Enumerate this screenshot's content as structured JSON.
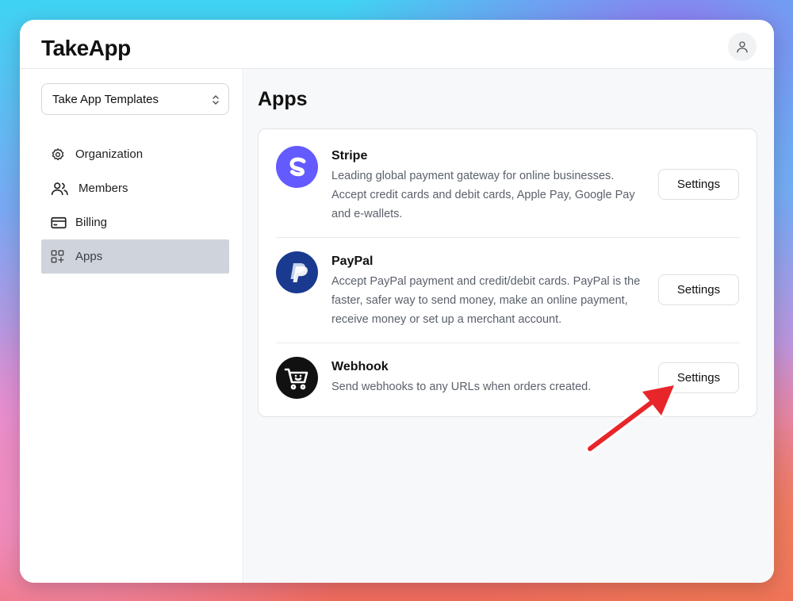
{
  "header": {
    "logo": "TakeApp",
    "user_icon": "user-icon"
  },
  "sidebar": {
    "org_select_value": "Take App Templates",
    "items": [
      {
        "label": "Organization",
        "icon": "gear-icon"
      },
      {
        "label": "Members",
        "icon": "users-icon"
      },
      {
        "label": "Billing",
        "icon": "credit-card-icon"
      },
      {
        "label": "Apps",
        "icon": "apps-grid-icon",
        "active": true
      }
    ]
  },
  "main": {
    "title": "Apps",
    "apps": [
      {
        "name": "Stripe",
        "description": "Leading global payment gateway for online businesses. Accept credit cards and debit cards, Apple Pay, Google Pay and e-wallets.",
        "button": "Settings",
        "icon": "stripe-logo-icon"
      },
      {
        "name": "PayPal",
        "description": "Accept PayPal payment and credit/debit cards. PayPal is the faster, safer way to send money, make an online payment, receive money or set up a merchant account.",
        "button": "Settings",
        "icon": "paypal-logo-icon"
      },
      {
        "name": "Webhook",
        "description": "Send webhooks to any URLs when orders created.",
        "button": "Settings",
        "icon": "cart-logo-icon"
      }
    ]
  },
  "colors": {
    "stripe": "#635bff",
    "paypal": "#1a3a8f",
    "webhook": "#111111",
    "arrow": "#e8262a",
    "active_nav": "#cfd3dc"
  }
}
